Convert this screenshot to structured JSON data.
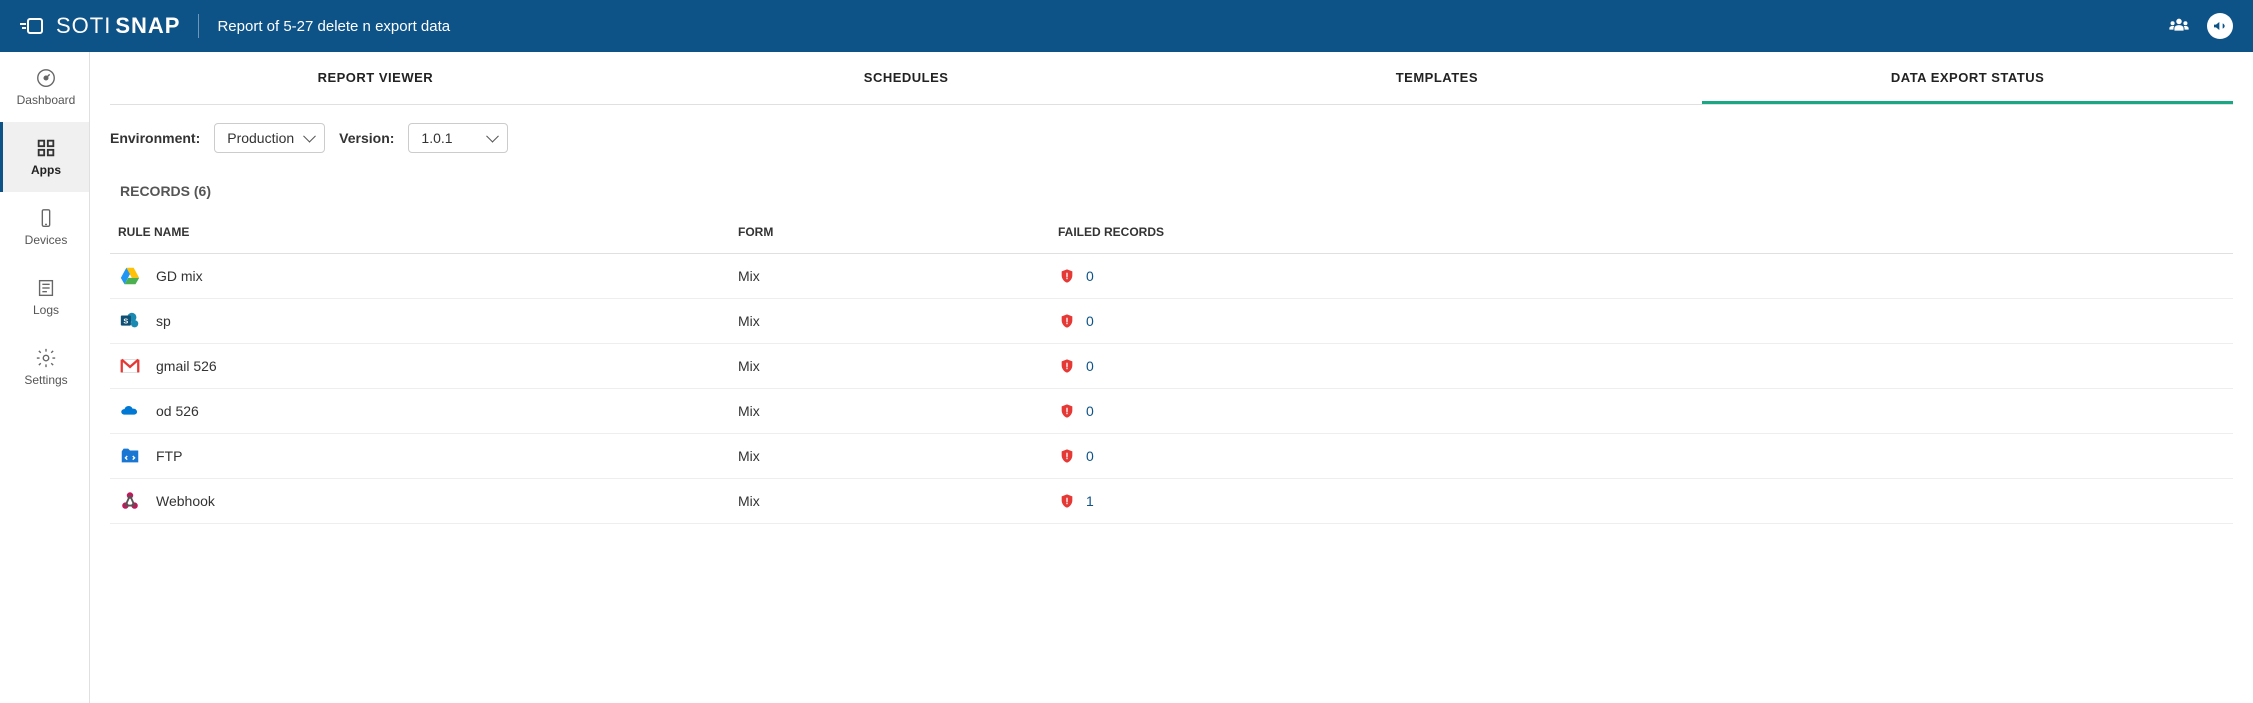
{
  "header": {
    "product_brand": "SOTI",
    "product_name": "SNAP",
    "page_title": "Report of 5-27 delete n export data"
  },
  "sidebar": {
    "items": [
      {
        "id": "dashboard",
        "label": "Dashboard",
        "icon": "dashboard",
        "active": false
      },
      {
        "id": "apps",
        "label": "Apps",
        "icon": "apps",
        "active": true
      },
      {
        "id": "devices",
        "label": "Devices",
        "icon": "devices",
        "active": false
      },
      {
        "id": "logs",
        "label": "Logs",
        "icon": "logs",
        "active": false
      },
      {
        "id": "settings",
        "label": "Settings",
        "icon": "settings",
        "active": false
      }
    ]
  },
  "tabs": [
    {
      "id": "report-viewer",
      "label": "REPORT VIEWER",
      "active": false
    },
    {
      "id": "schedules",
      "label": "SCHEDULES",
      "active": false
    },
    {
      "id": "templates",
      "label": "TEMPLATES",
      "active": false
    },
    {
      "id": "data-export-status",
      "label": "DATA EXPORT STATUS",
      "active": true
    }
  ],
  "filters": {
    "env_label": "Environment:",
    "env_value": "Production",
    "version_label": "Version:",
    "version_value": "1.0.1"
  },
  "section": {
    "title": "RECORDS (6)"
  },
  "table": {
    "headers": {
      "rule_name": "RULE NAME",
      "form": "FORM",
      "failed": "FAILED RECORDS"
    },
    "rows": [
      {
        "icon": "gdrive",
        "rule": "GD mix",
        "form": "Mix",
        "failed": 0
      },
      {
        "icon": "sharepoint",
        "rule": "sp",
        "form": "Mix",
        "failed": 0
      },
      {
        "icon": "gmail",
        "rule": "gmail 526",
        "form": "Mix",
        "failed": 0
      },
      {
        "icon": "onedrive",
        "rule": "od 526",
        "form": "Mix",
        "failed": 0
      },
      {
        "icon": "ftp",
        "rule": "FTP",
        "form": "Mix",
        "failed": 0
      },
      {
        "icon": "webhook",
        "rule": "Webhook",
        "form": "Mix",
        "failed": 1
      }
    ]
  }
}
